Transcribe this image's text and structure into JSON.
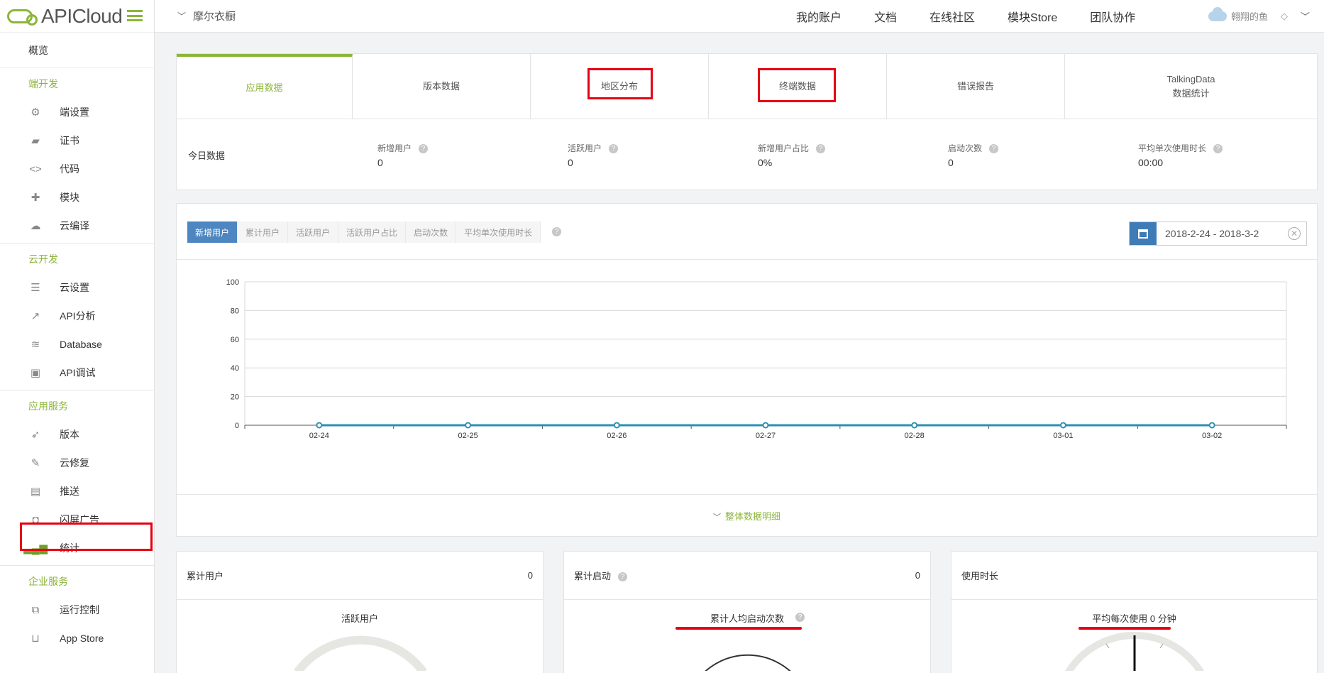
{
  "sidebar": {
    "brand": "APICloud",
    "overview": "概览",
    "sections": [
      {
        "title": "端开发",
        "items": [
          {
            "label": "端设置",
            "icon": "gear-icon"
          },
          {
            "label": "证书",
            "icon": "certificate-icon"
          },
          {
            "label": "代码",
            "icon": "code-icon"
          },
          {
            "label": "模块",
            "icon": "puzzle-icon"
          },
          {
            "label": "云编译",
            "icon": "cloud-icon"
          }
        ]
      },
      {
        "title": "云开发",
        "items": [
          {
            "label": "云设置",
            "icon": "sliders-icon"
          },
          {
            "label": "API分析",
            "icon": "line-chart-icon"
          },
          {
            "label": "Database",
            "icon": "database-icon"
          },
          {
            "label": "API调试",
            "icon": "debug-icon"
          }
        ]
      },
      {
        "title": "应用服务",
        "items": [
          {
            "label": "版本",
            "icon": "rocket-icon"
          },
          {
            "label": "云修复",
            "icon": "wrench-icon"
          },
          {
            "label": "推送",
            "icon": "push-icon"
          },
          {
            "label": "闪屏广告",
            "icon": "ad-icon"
          },
          {
            "label": "统计",
            "icon": "bar-chart-icon"
          }
        ]
      },
      {
        "title": "企业服务",
        "items": [
          {
            "label": "运行控制",
            "icon": "control-icon"
          },
          {
            "label": "App Store",
            "icon": "bag-icon"
          }
        ]
      }
    ]
  },
  "topbar": {
    "project": "摩尔衣橱",
    "nav": [
      "我的账户",
      "文档",
      "在线社区",
      "模块Store",
      "团队协作"
    ],
    "user": "翱翔的鱼"
  },
  "tabs": [
    {
      "label": "应用数据"
    },
    {
      "label": "版本数据"
    },
    {
      "label": "地区分布"
    },
    {
      "label": "终端数据"
    },
    {
      "label": "错误报告"
    },
    {
      "label": "TalkingData",
      "label2": "数据统计"
    }
  ],
  "today": {
    "label": "今日数据",
    "stats": [
      {
        "label": "新增用户",
        "value": "0"
      },
      {
        "label": "活跃用户",
        "value": "0"
      },
      {
        "label": "新增用户占比",
        "value": "0%"
      },
      {
        "label": "启动次数",
        "value": "0"
      },
      {
        "label": "平均单次使用时长",
        "value": "00:00"
      }
    ]
  },
  "subtabs": [
    "新增用户",
    "累计用户",
    "活跃用户",
    "活跃用户占比",
    "启动次数",
    "平均单次使用时长"
  ],
  "daterange": "2018-2-24 - 2018-3-2",
  "detail_label": "整体数据明细",
  "chart_data": {
    "type": "line",
    "x": [
      "02-24",
      "02-25",
      "02-26",
      "02-27",
      "02-28",
      "03-01",
      "03-02"
    ],
    "series": [
      {
        "values": [
          0,
          0,
          0,
          0,
          0,
          0,
          0
        ]
      }
    ],
    "yticks": [
      0,
      20,
      40,
      60,
      80,
      100
    ],
    "ylim": [
      0,
      100
    ],
    "grid": true,
    "color": "#2e8fb3"
  },
  "cards": [
    {
      "title": "累计用户",
      "value": "0",
      "sub": "活跃用户"
    },
    {
      "title": "累计启动",
      "value": "0",
      "sub": "累计人均启动次数"
    },
    {
      "title": "使用时长",
      "value": "",
      "sub": "平均每次使用 0 分钟"
    }
  ],
  "colors": {
    "brand": "#8cb53a",
    "primary": "#4d86c0",
    "highlight": "#e60012"
  }
}
